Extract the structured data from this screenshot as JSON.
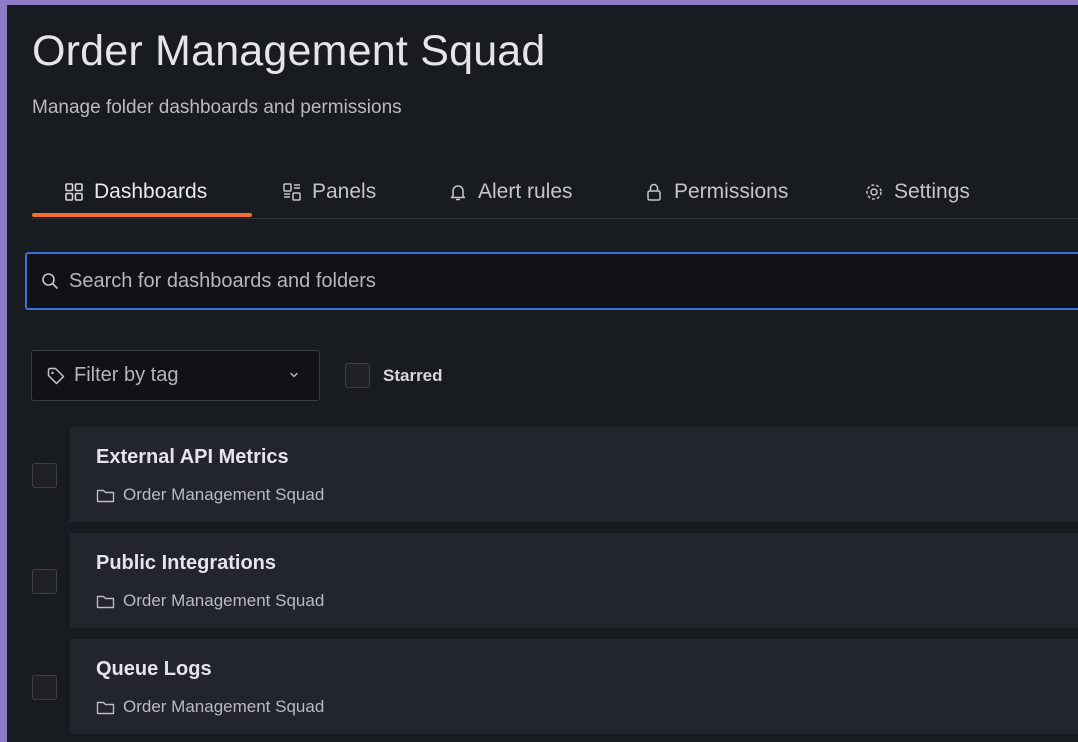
{
  "folder": {
    "title": "Order Management Squad",
    "subtitle": "Manage folder dashboards and permissions"
  },
  "tabs": [
    {
      "label": "Dashboards",
      "icon": "apps-icon",
      "active": true
    },
    {
      "label": "Panels",
      "icon": "library-panel-icon",
      "active": false
    },
    {
      "label": "Alert rules",
      "icon": "bell-icon",
      "active": false
    },
    {
      "label": "Permissions",
      "icon": "lock-icon",
      "active": false
    },
    {
      "label": "Settings",
      "icon": "cog-icon",
      "active": false
    }
  ],
  "search": {
    "placeholder": "Search for dashboards and folders",
    "icon": "search-icon",
    "value": ""
  },
  "filters": {
    "tag_placeholder": "Filter by tag",
    "starred_label": "Starred",
    "starred_checked": false
  },
  "dashboards": [
    {
      "title": "External API Metrics",
      "folder": "Order Management Squad"
    },
    {
      "title": "Public Integrations",
      "folder": "Order Management Squad"
    },
    {
      "title": "Queue Logs",
      "folder": "Order Management Squad"
    }
  ],
  "colors": {
    "accent_underline": "#f26f2f",
    "search_focus_border": "#3d71d9",
    "panel_bg": "#181b1f",
    "card_bg": "#22252b",
    "frame": "#8f7bc6"
  }
}
